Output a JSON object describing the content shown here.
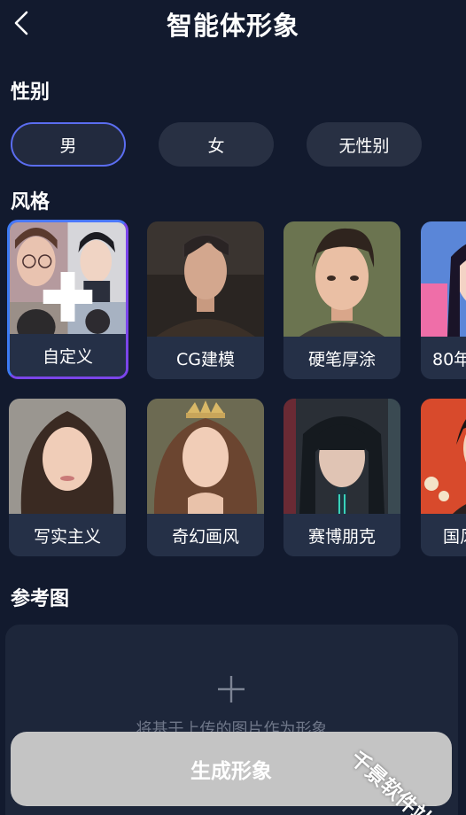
{
  "header": {
    "title": "智能体形象",
    "back_icon": "chevron-left-icon"
  },
  "gender": {
    "label": "性别",
    "options": [
      "男",
      "女",
      "无性别"
    ],
    "selected": "男"
  },
  "style": {
    "label": "风格",
    "items": [
      "自定义",
      "CG建模",
      "硬笔厚涂",
      "80年",
      "写实主义",
      "奇幻画风",
      "赛博朋克",
      "国风"
    ],
    "selected": "自定义"
  },
  "reference": {
    "label": "参考图",
    "hint": "将基于上传的图片作为形象",
    "add_icon": "plus-icon"
  },
  "generate_label": "生成形象",
  "watermark": "千景软件站",
  "colors": {
    "background": "#121a2e",
    "accent_blue": "#4a78ff",
    "accent_purple": "#7b45ea",
    "button_disabled": "#c4c4c4"
  }
}
